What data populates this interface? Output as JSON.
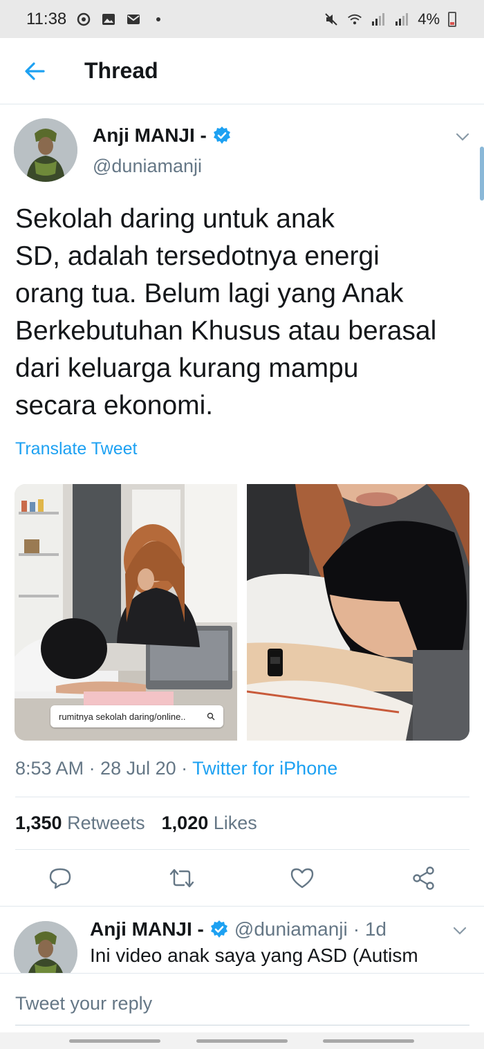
{
  "status_bar": {
    "time": "11:38",
    "battery": "4%",
    "left_icons": [
      "sync-icon",
      "gallery-icon",
      "mail-icon",
      "dot-icon"
    ],
    "right_icons": [
      "mute-icon",
      "wifi-icon",
      "signal-icon",
      "signal-icon",
      "battery-icon"
    ]
  },
  "header": {
    "title": "Thread",
    "back_icon": "back-arrow-icon"
  },
  "tweet": {
    "author_name": "Anji MANJI -",
    "handle": "@duniamanji",
    "verified": true,
    "text_lines": [
      "Sekolah daring untuk anak",
      "SD, adalah tersedotnya energi",
      "orang tua. Belum lagi yang Anak",
      "Berkebutuhan Khusus atau berasal",
      "dari keluarga kurang mampu",
      "secara ekonomi."
    ],
    "translate_label": "Translate Tweet",
    "media_left_caption": "rumitnya sekolah daring/online..",
    "timestamp": "8:53 AM · 28 Jul 20 · ",
    "source": "Twitter for iPhone",
    "retweets_count": "1,350",
    "retweets_label": "Retweets",
    "likes_count": "1,020",
    "likes_label": "Likes",
    "actions": [
      "reply-icon",
      "retweet-icon",
      "like-icon",
      "share-icon"
    ]
  },
  "reply_tweet": {
    "author_name": "Anji MANJI -",
    "handle": "@duniamanji",
    "time": "· 1d",
    "text": "Ini video anak saya yang ASD (Autism"
  },
  "composer": {
    "placeholder": "Tweet your reply"
  },
  "colors": {
    "accent": "#1da1f2",
    "secondary_text": "#657786",
    "primary_text": "#14171a",
    "status_bar_bg": "#e9e9e9"
  }
}
